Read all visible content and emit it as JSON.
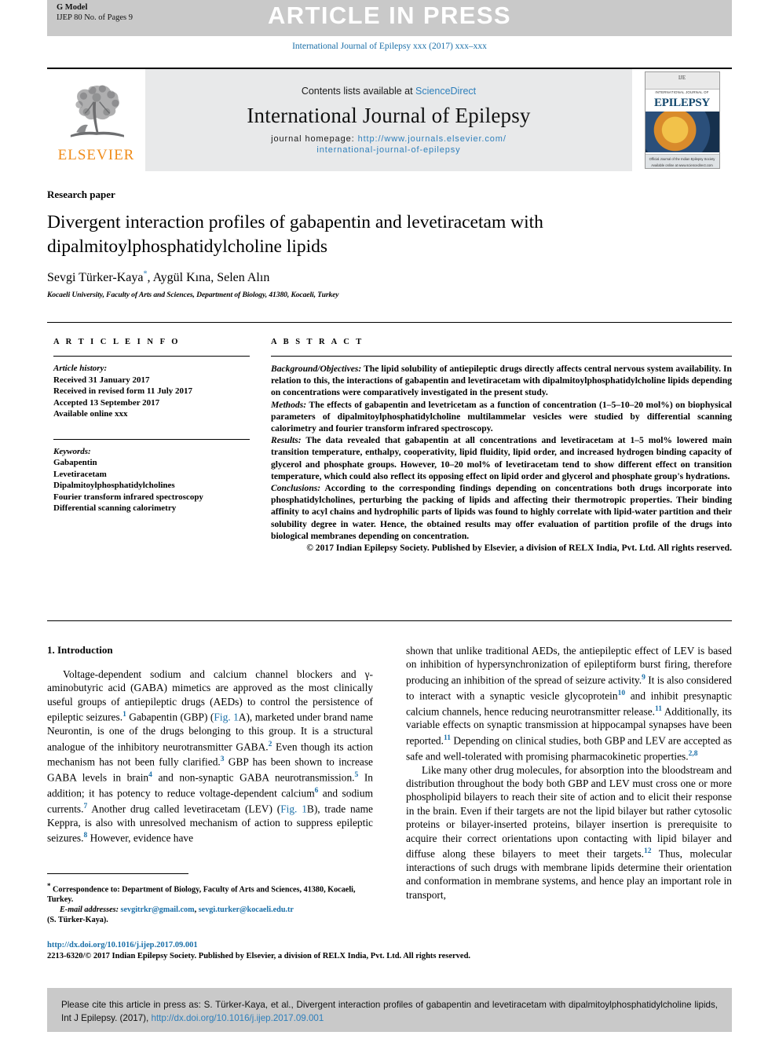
{
  "header": {
    "gmodel_label": "G Model",
    "gmodel_id": "IJEP 80 No. of Pages 9",
    "article_in_press": "ARTICLE IN PRESS",
    "running_head": "International Journal of Epilepsy xxx (2017) xxx–xxx"
  },
  "masthead": {
    "publisher_wordmark": "ELSEVIER",
    "contents_prefix": "Contents lists available at ",
    "contents_link": "ScienceDirect",
    "journal_name": "International Journal of Epilepsy",
    "homepage_label": "journal homepage: ",
    "homepage_url_line1": "http://www.journals.elsevier.com/",
    "homepage_url_line2": "international-journal-of-epilepsy",
    "cover": {
      "logo": "IJE",
      "subtitle": "INTERNATIONAL JOURNAL OF",
      "title": "EPILEPSY",
      "footer_line1": "Official Journal of the Indian Epilepsy Society",
      "footer_line2": "Available online at www.sciencedirect.com"
    }
  },
  "article": {
    "kind": "Research paper",
    "title": "Divergent interaction profiles of gabapentin and levetiracetam with dipalmitoylphosphatidylcholine lipids",
    "authors": "Sevgi Türker-Kaya, Aygül Kına, Selen Alın",
    "author_marker": "*",
    "affiliation": "Kocaeli University, Faculty of Arts and Sciences, Department of Biology, 41380, Kocaeli, Turkey"
  },
  "article_info": {
    "heading": "A R T I C L E   I N F O",
    "history_label": "Article history:",
    "history": [
      "Received 31 January 2017",
      "Received in revised form 11 July 2017",
      "Accepted 13 September 2017",
      "Available online xxx"
    ],
    "keywords_label": "Keywords:",
    "keywords": [
      "Gabapentin",
      "Levetiracetam",
      "Dipalmitoylphosphatidylcholines",
      "Fourier transform infrared spectroscopy",
      "Differential scanning calorimetry"
    ]
  },
  "abstract": {
    "heading": "A B S T R A C T",
    "background_label": "Background/Objectives:",
    "background_text": " The lipid solubility of antiepileptic drugs directly affects central nervous system availability. In relation to this, the interactions of gabapentin and levetiracetam with dipalmitoylphosphatidylcholine lipids depending on concentrations were comparatively investigated in the present study.",
    "methods_label": "Methods:",
    "methods_text": " The effects of gabapentin and levetricetam as a function of concentration (1–5–10–20 mol%) on biophysical parameters of dipalmitoylphosphatidylcholine multilammelar vesicles were studied by differential scanning calorimetry and fourier transform infrared spectroscopy.",
    "results_label": "Results:",
    "results_text": " The data revealed that gabapentin at all concentrations and levetiracetam at 1–5 mol% lowered main transition temperature, enthalpy, cooperativity, lipid fluidity, lipid order, and increased hydrogen binding capacity of glycerol and phosphate groups. However, 10–20 mol% of levetiracetam tend to show different effect on transition temperature, which could also reflect its opposing effect on lipid order and glycerol and phosphate group's hydrations.",
    "conclusions_label": "Conclusions:",
    "conclusions_text": " According to the corresponding findings depending on concentrations both drugs incorporate into phosphatidylcholines, perturbing the packing of lipids and affecting their thermotropic properties. Their binding affinity to acyl chains and hydrophilic parts of lipids was found to highly correlate with lipid-water partition and their solubility degree in water. Hence, the obtained results may offer evaluation of partition profile of the drugs into biological membranes depending on concentration.",
    "copyright": "© 2017 Indian Epilepsy Society. Published by Elsevier, a division of RELX India, Pvt. Ltd. All rights reserved."
  },
  "intro": {
    "heading": "1. Introduction",
    "left_p1_a": "Voltage-dependent sodium and calcium channel blockers and γ-aminobutyric acid (GABA) mimetics are approved as the most clinically useful groups of antiepileptic drugs (AEDs) to control the persistence of epileptic seizures.",
    "left_r1": "1",
    "left_p1_b": " Gabapentin (GBP) (",
    "left_fig1a": "Fig. 1",
    "left_p1_c": "A), marketed under brand name Neurontin, is one of the drugs belonging to this group. It is a structural analogue of the inhibitory neurotransmitter GABA.",
    "left_r2": "2",
    "left_p1_d": " Even though its action mechanism has not been fully clarified.",
    "left_r3": "3",
    "left_p1_e": " GBP has been shown to increase GABA levels in brain",
    "left_r4": "4",
    "left_p1_f": " and non-synaptic GABA neurotransmission.",
    "left_r5": "5",
    "left_p1_g": " In addition; it has potency to reduce voltage-dependent calcium",
    "left_r6": "6",
    "left_p1_h": " and sodium currents.",
    "left_r7": "7",
    "left_p1_i": " Another drug called levetiracetam (LEV) (",
    "left_fig1b": "Fig. 1",
    "left_p1_j": "B), trade name Keppra, is also with unresolved mechanism of action to suppress epileptic seizures.",
    "left_r8": "8",
    "left_p1_k": " However, evidence have",
    "right_p1_a": "shown that unlike traditional AEDs, the antiepileptic effect of LEV is based on inhibition of hypersynchronization of epileptiform burst firing, therefore producing an inhibition of the spread of seizure activity.",
    "right_r9": "9",
    "right_p1_b": " It is also considered to interact with a synaptic vesicle glycoprotein",
    "right_r10": "10",
    "right_p1_c": " and inhibit presynaptic calcium channels, hence reducing neurotransmitter release.",
    "right_r11": "11",
    "right_p1_d": " Additionally, its variable effects on synaptic transmission at hippocampal synapses have been reported.",
    "right_r11b": "11",
    "right_p1_e": " Depending on clinical studies, both GBP and LEV are accepted as safe and well-tolerated with promising pharmacokinetic properties.",
    "right_r28": "2,8",
    "right_p2_a": "Like many other drug molecules, for absorption into the bloodstream and distribution throughout the body both GBP and LEV must cross one or more phospholipid bilayers to reach their site of action and to elicit their response in the brain. Even if their targets are not the lipid bilayer but rather cytosolic proteins or bilayer-inserted proteins, bilayer insertion is prerequisite to acquire their correct orientations upon contacting with lipid bilayer and diffuse along these bilayers to meet their targets.",
    "right_r12": "12",
    "right_p2_b": " Thus, molecular interactions of such drugs with membrane lipids determine their orientation and conformation in membrane systems, and hence play an important role in transport,"
  },
  "footnotes": {
    "correspondence_marker": "*",
    "correspondence": " Correspondence to: Department of Biology, Faculty of Arts and Sciences, 41380, Kocaeli, Turkey.",
    "email_label": "E-mail addresses:",
    "email1": "sevgitrkr@gmail.com",
    "email2": "sevgi.turker@kocaeli.edu.tr",
    "email_author": "(S. Türker-Kaya)."
  },
  "footer": {
    "doi": "http://dx.doi.org/10.1016/j.ijep.2017.09.001",
    "issn_line": "2213-6320/© 2017 Indian Epilepsy Society. Published by Elsevier, a division of RELX India, Pvt. Ltd. All rights reserved."
  },
  "cite_box": {
    "text": "Please cite this article in press as: S. Türker-Kaya, et al., Divergent interaction profiles of gabapentin and levetiracetam with dipalmitoylphosphatidylcholine lipids, Int J Epilepsy. (2017), ",
    "link": "http://dx.doi.org/10.1016/j.ijep.2017.09.001"
  },
  "colors": {
    "link_blue": "#2e7fbb",
    "ref_blue": "#1a6fa8",
    "band_grey": "#c9c9c9",
    "masthead_grey": "#e8e9ea",
    "elsevier_orange": "#F08C1A"
  }
}
